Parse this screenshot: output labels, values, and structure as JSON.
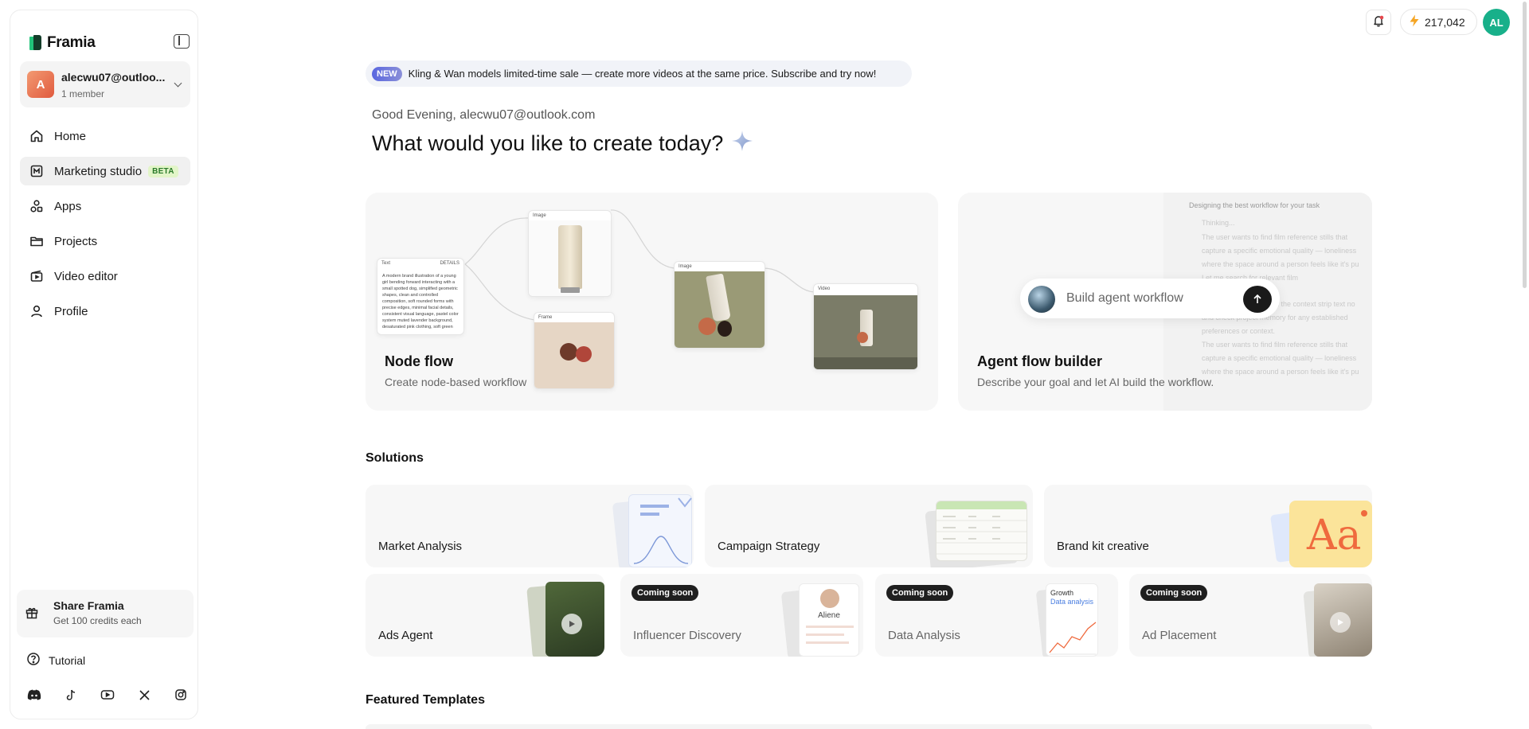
{
  "brand": {
    "name": "Framia"
  },
  "account": {
    "avatar_letter": "A",
    "email": "alecwu07@outloo...",
    "members": "1 member"
  },
  "nav": {
    "items": [
      {
        "label": "Home",
        "icon": "home-icon"
      },
      {
        "label": "Marketing studio",
        "icon": "marketing-icon",
        "badge": "BETA"
      },
      {
        "label": "Apps",
        "icon": "apps-icon"
      },
      {
        "label": "Projects",
        "icon": "folder-icon"
      },
      {
        "label": "Video editor",
        "icon": "video-editor-icon"
      },
      {
        "label": "Profile",
        "icon": "profile-icon"
      }
    ]
  },
  "share": {
    "title": "Share Framia",
    "subtitle": "Get 100 credits each"
  },
  "tutorial": {
    "label": "Tutorial"
  },
  "socials": [
    "discord-icon",
    "tiktok-icon",
    "youtube-icon",
    "x-icon",
    "instagram-icon"
  ],
  "topbar": {
    "credits": "217,042",
    "user_initials": "AL"
  },
  "banner": {
    "badge": "NEW",
    "text": "Kling & Wan models limited-time sale — create more videos at the same price. Subscribe and try now!"
  },
  "greeting": "Good Evening, alecwu07@outlook.com",
  "headline": "What would you like to create today?",
  "cards": {
    "node_flow": {
      "title": "Node flow",
      "subtitle": "Create node-based workflow",
      "nodes": {
        "text_label": "Text",
        "text_tag": "DETAILS",
        "text_body": "A modern brand illustration of a young girl bending forward interacting with a small spotted dog, simplified geometric shapes, clean and controlled composition, soft rounded forms with precise edges, minimal facial details, consistent visual language, pastel color system muted lavender background, desaturated pink clothing, soft green base with subtle floral accents...",
        "image_label": "Image",
        "image2_label": "Image",
        "frame_label": "Frame",
        "video_label": "Video"
      }
    },
    "agent_flow": {
      "title": "Agent flow builder",
      "subtitle": "Describe your goal and let AI build the workflow.",
      "placeholder": "Build agent workflow",
      "bg_header": "Designing the best workflow for your task",
      "bg_thinking": "Thinking...",
      "bg_lines": [
        "The user wants to find film reference stills that",
        "capture a specific emotional quality — loneliness",
        "where the space around a person feels like it's pu",
        "Let me search for relevant film",
        "",
        "",
        "Let me also quickly read the context strip text no",
        "and check project memory for any established",
        "preferences or context.",
        "The user wants to find film reference stills that",
        "capture a specific emotional quality — loneliness",
        "where the space around a person feels like it's pu"
      ]
    }
  },
  "solutions": {
    "title": "Solutions",
    "row1": [
      {
        "label": "Market Analysis"
      },
      {
        "label": "Campaign Strategy"
      },
      {
        "label": "Brand kit creative"
      }
    ],
    "row2": [
      {
        "label": "Ads Agent"
      },
      {
        "label": "Influencer Discovery",
        "badge": "Coming soon",
        "thumb_name": "Aliene"
      },
      {
        "label": "Data Analysis",
        "badge": "Coming soon",
        "thumb_title": "Growth",
        "thumb_sub": "Data analysis"
      },
      {
        "label": "Ad Placement",
        "badge": "Coming soon"
      }
    ]
  },
  "featured": {
    "title": "Featured Templates"
  }
}
